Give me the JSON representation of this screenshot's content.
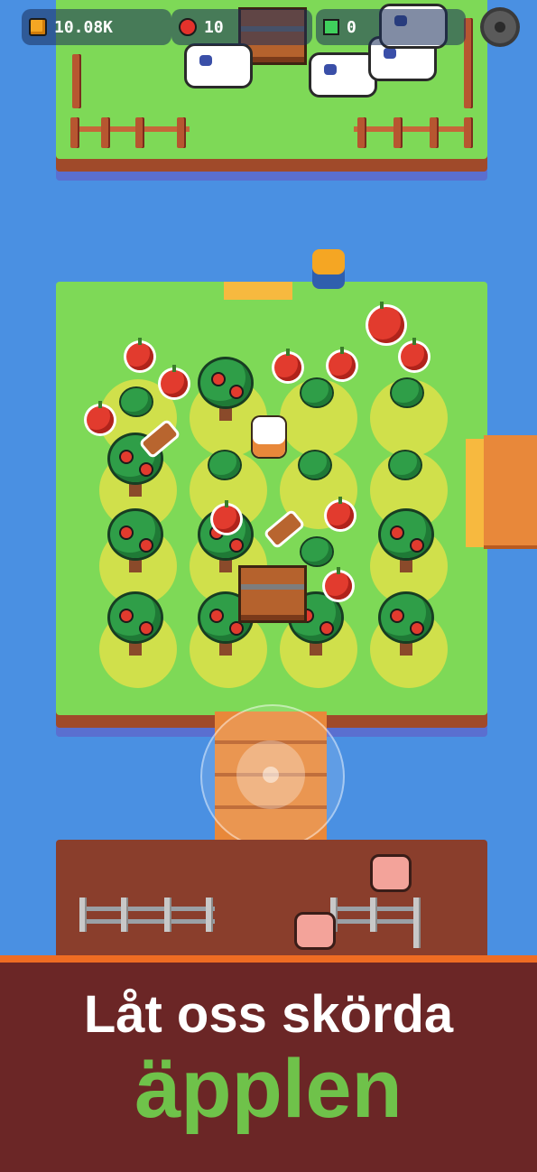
{
  "hud": {
    "coins": "10.08K",
    "apples": "10",
    "gems": "0"
  },
  "banner": {
    "line1": "Låt oss skörda",
    "line2": "äpplen"
  },
  "colors": {
    "water": "#4a90e2",
    "grass": "#7ed957",
    "banner_bg": "#6b2626",
    "banner_accent": "#ef6c23",
    "headline_green": "#6fc24a"
  },
  "icons": [
    "coin-icon",
    "apple-icon",
    "gem-icon",
    "gear-icon"
  ]
}
